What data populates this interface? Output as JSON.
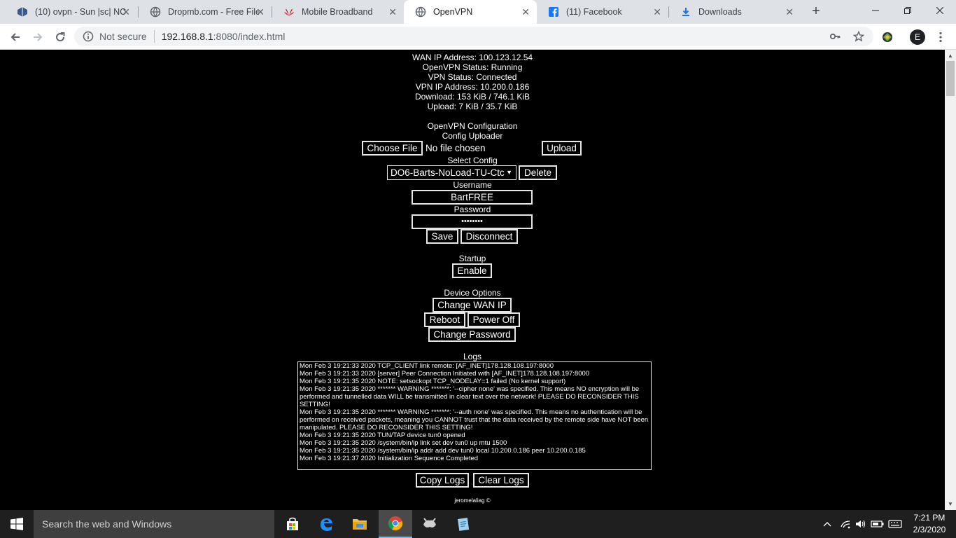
{
  "browser": {
    "tabs": [
      {
        "title": "(10) ovpn - Sun |sc| NC",
        "icon": "app-icon"
      },
      {
        "title": "Dropmb.com - Free File",
        "icon": "globe-icon"
      },
      {
        "title": "Mobile Broadband",
        "icon": "huawei-icon"
      },
      {
        "title": "OpenVPN",
        "icon": "globe-icon"
      },
      {
        "title": "(11) Facebook",
        "icon": "facebook-icon"
      },
      {
        "title": "Downloads",
        "icon": "download-icon"
      }
    ],
    "active_tab": 3,
    "security_label": "Not secure",
    "url_host": "192.168.8.1",
    "url_rest": ":8080/index.html",
    "profile_initial": "E"
  },
  "status": {
    "wan_ip": "WAN IP Address: 100.123.12.54",
    "openvpn_status": "OpenVPN Status: Running",
    "vpn_status": "VPN Status: Connected",
    "vpn_ip": "VPN IP Address: 10.200.0.186",
    "download": "Download: 153 KiB / 746.1 KiB",
    "upload": "Upload: 7 KiB / 35.7 KiB"
  },
  "config": {
    "heading": "OpenVPN Configuration",
    "uploader_label": "Config Uploader",
    "choose_file": "Choose File",
    "no_file": "No file chosen",
    "upload": "Upload",
    "select_label": "Select Config",
    "selected_config": "DO6-Barts-NoLoad-TU-Ctc",
    "delete": "Delete",
    "username_label": "Username",
    "username_value": "BartFREE",
    "password_label": "Password",
    "password_value": "••••••••",
    "save": "Save",
    "disconnect": "Disconnect"
  },
  "startup": {
    "label": "Startup",
    "enable": "Enable"
  },
  "device": {
    "label": "Device Options",
    "change_wan_ip": "Change WAN IP",
    "reboot": "Reboot",
    "power_off": "Power Off",
    "change_password": "Change Password"
  },
  "logs": {
    "label": "Logs",
    "lines": [
      "Mon Feb  3 19:21:33 2020 TCP_CLIENT link remote: [AF_INET]178.128.108.197:8000",
      "Mon Feb  3 19:21:33 2020 [server] Peer Connection Initiated with [AF_INET]178.128.108.197:8000",
      "Mon Feb  3 19:21:35 2020 NOTE: setsockopt TCP_NODELAY=1 failed (No kernel support)",
      "Mon Feb  3 19:21:35 2020 ******* WARNING *******: '--cipher none' was specified. This means NO encryption will be performed and tunnelled data WILL be transmitted in clear text over the network! PLEASE DO RECONSIDER THIS SETTING!",
      "Mon Feb  3 19:21:35 2020 ******* WARNING *******: '--auth none' was specified. This means no authentication will be performed on received packets, meaning you CANNOT trust that the data received by the remote side have NOT been manipulated. PLEASE DO RECONSIDER THIS SETTING!",
      "Mon Feb  3 19:21:35 2020 TUN/TAP device tun0 opened",
      "Mon Feb  3 19:21:35 2020 /system/bin/ip link set dev tun0 up mtu 1500",
      "Mon Feb  3 19:21:35 2020 /system/bin/ip addr add dev tun0 local 10.200.0.186 peer 10.200.0.185",
      "Mon Feb  3 19:21:37 2020 Initialization Sequence Completed"
    ],
    "copy": "Copy Logs",
    "clear": "Clear Logs"
  },
  "footer": "jeromelaliag ©",
  "taskbar": {
    "search_placeholder": "Search the web and Windows",
    "time": "7:21 PM",
    "date": "2/3/2020"
  }
}
